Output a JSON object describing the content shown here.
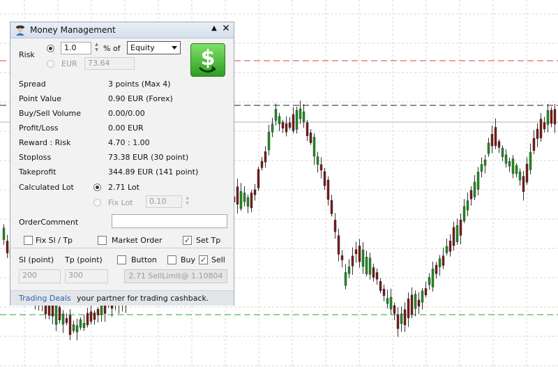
{
  "chart": {
    "colors": {
      "up": "#1f8f1f",
      "down": "#7a1a1a",
      "grid": "#d4d4d4",
      "red_line": "#e83a3a",
      "black_line": "#222222",
      "green_line": "#2aa02a",
      "price_line": "#b0b0b0"
    }
  },
  "panel": {
    "title": "Money Management",
    "minimize_icon": "triangle-up-icon",
    "close_icon": "close-icon",
    "risk": {
      "label": "Risk",
      "percent_value": "1.0",
      "percent_of_label": "% of",
      "basis_selected": "Equity",
      "currency_label": "EUR",
      "currency_value": "73.64"
    },
    "info_rows": [
      {
        "label": "Spread",
        "value": "3 points  (Max 4)"
      },
      {
        "label": "Point Value",
        "value": "0.90 EUR (Forex)"
      },
      {
        "label": "Buy/Sell Volume",
        "value": "0.00/0.00"
      },
      {
        "label": "Profit/Loss",
        "value": "0.00 EUR"
      },
      {
        "label": "Reward : Risk",
        "value": "4.70 : 1.00"
      },
      {
        "label": "Stoploss",
        "value": "73.38 EUR (30 point)"
      },
      {
        "label": "Takeprofit",
        "value": "344.89 EUR (141 point)"
      }
    ],
    "lot": {
      "label": "Calculated Lot",
      "calculated_value": "2.71 Lot",
      "fix_label": "Fix Lot",
      "fix_value": "0.10"
    },
    "order_comment": {
      "label": "OrderComment",
      "value": ""
    },
    "options": {
      "fix_sl_tp": "Fix Sl / Tp",
      "market_order": "Market Order",
      "set_tp": "Set Tp"
    },
    "sl_label": "Sl (point)",
    "tp_label": "Tp (point)",
    "sl_value": "200",
    "tp_value": "300",
    "button_label": "Button",
    "buy_label": "Buy",
    "sell_label": "Sell",
    "order_button": "2.71 SellLimit@ 1.10804",
    "footer": {
      "link": "Trading Deals",
      "text": " your partner for trading cashback."
    }
  }
}
